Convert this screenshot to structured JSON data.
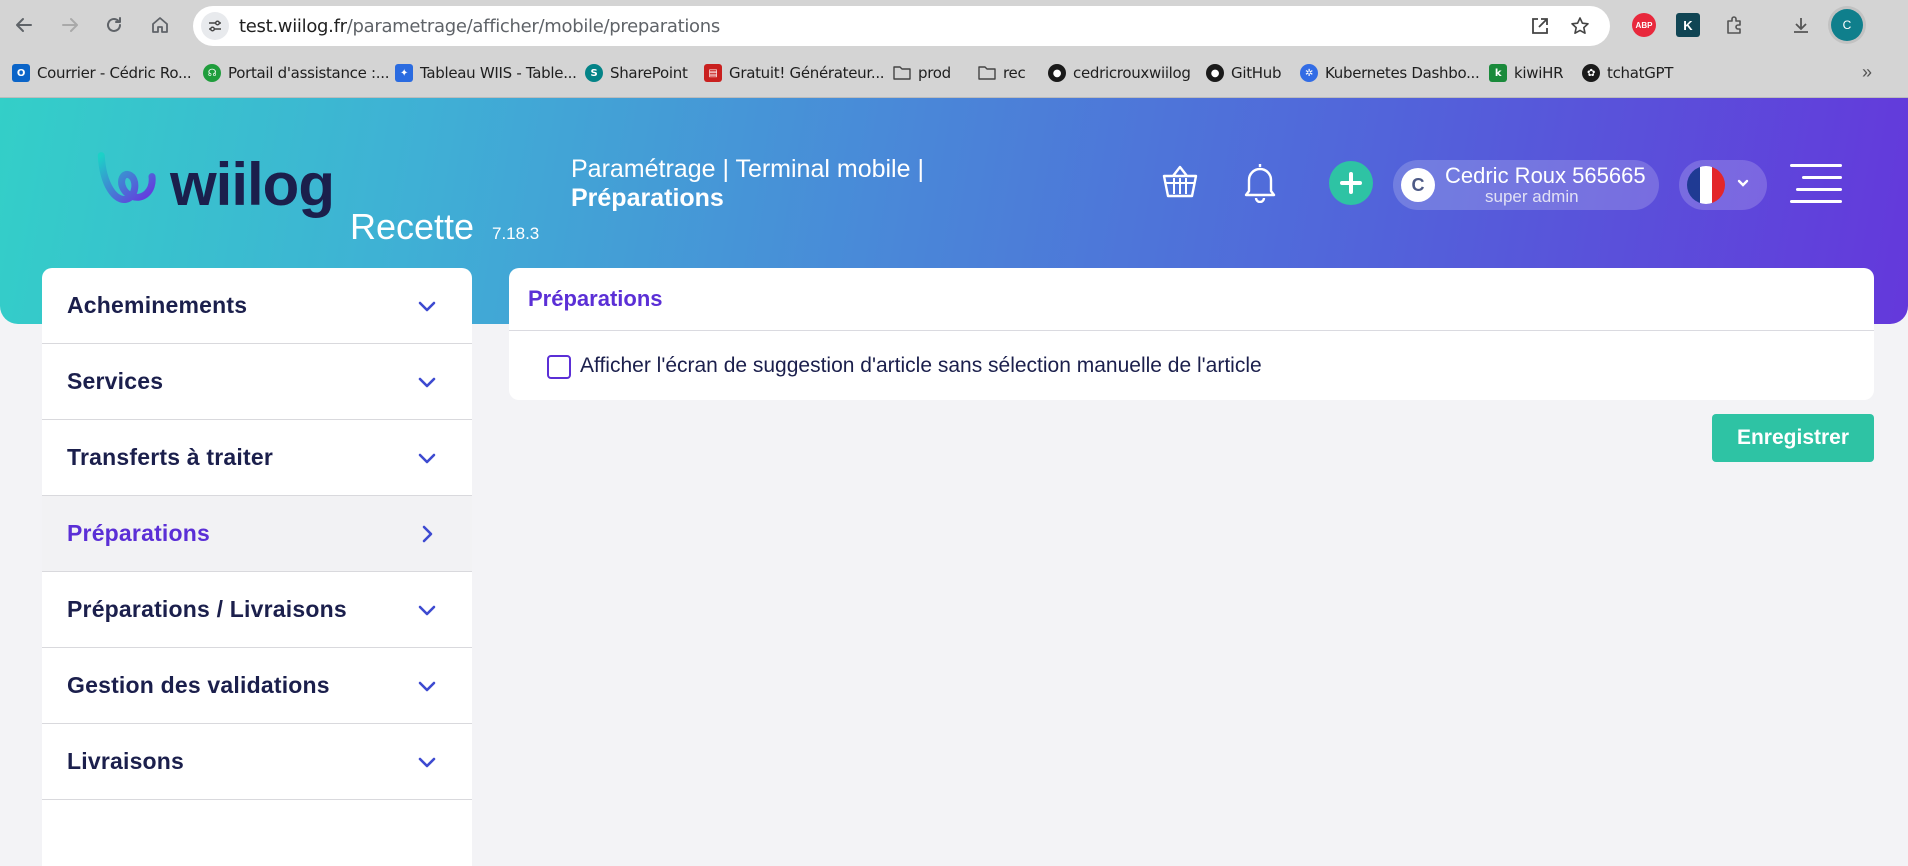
{
  "browser": {
    "url_host": "test.wiilog.fr",
    "url_path": "/parametrage/afficher/mobile/preparations",
    "profile_initial": "C",
    "extensions": [
      {
        "name": "adblock-plus",
        "label": "ABP"
      },
      {
        "name": "extension",
        "label": "K"
      }
    ]
  },
  "bookmarks": [
    {
      "label": "Courrier - Cédric Ro...",
      "icon": "outlook-icon",
      "color": "#0a64c8"
    },
    {
      "label": "Portail d'assistance :...",
      "icon": "headset-icon",
      "color": "#1f9d3c"
    },
    {
      "label": "Tableau WIIS - Table...",
      "icon": "jira-icon",
      "color": "#2a6be0"
    },
    {
      "label": "SharePoint",
      "icon": "sharepoint-icon",
      "color": "#038387"
    },
    {
      "label": "Gratuit! Générateur...",
      "icon": "pdf-icon",
      "color": "#c9201f"
    },
    {
      "label": "prod",
      "icon": "folder-icon",
      "color": ""
    },
    {
      "label": "rec",
      "icon": "folder-icon",
      "color": ""
    },
    {
      "label": "cedricrouxwiilog",
      "icon": "github-icon",
      "color": "#1a1a1a"
    },
    {
      "label": "GitHub",
      "icon": "github-icon",
      "color": "#1a1a1a"
    },
    {
      "label": "Kubernetes Dashbo...",
      "icon": "kubernetes-icon",
      "color": "#326ce5"
    },
    {
      "label": "kiwiHR",
      "icon": "kiwi-icon",
      "color": "#1a8a3b"
    },
    {
      "label": "tchatGPT",
      "icon": "openai-icon",
      "color": "#1a1a1a"
    }
  ],
  "header": {
    "logo_text": "wiilog",
    "environment": "Recette",
    "version": "7.18.3",
    "breadcrumb": "Paramétrage | Terminal mobile |",
    "page_title": "Préparations",
    "user": {
      "initial": "C",
      "name": "Cedric Roux 565665",
      "role": "super admin"
    },
    "language": "fr",
    "flag_colors": [
      "#1f3a93",
      "#ffffff",
      "#e3262a"
    ]
  },
  "sidebar": {
    "items": [
      {
        "label": "Acheminements",
        "expanded": false
      },
      {
        "label": "Services",
        "expanded": false
      },
      {
        "label": "Transferts à traiter",
        "expanded": false
      },
      {
        "label": "Préparations",
        "active": true
      },
      {
        "label": "Préparations / Livraisons",
        "expanded": false
      },
      {
        "label": "Gestion des validations",
        "expanded": false
      },
      {
        "label": "Livraisons",
        "expanded": false
      }
    ]
  },
  "main": {
    "card_title": "Préparations",
    "setting_label": "Afficher l'écran de suggestion d'article sans sélection manuelle de l'article",
    "setting_checked": false,
    "save_label": "Enregistrer"
  },
  "colors": {
    "accent_purple": "#5b2fd6",
    "accent_green": "#2ec3a4",
    "navy": "#1b1f4c"
  }
}
